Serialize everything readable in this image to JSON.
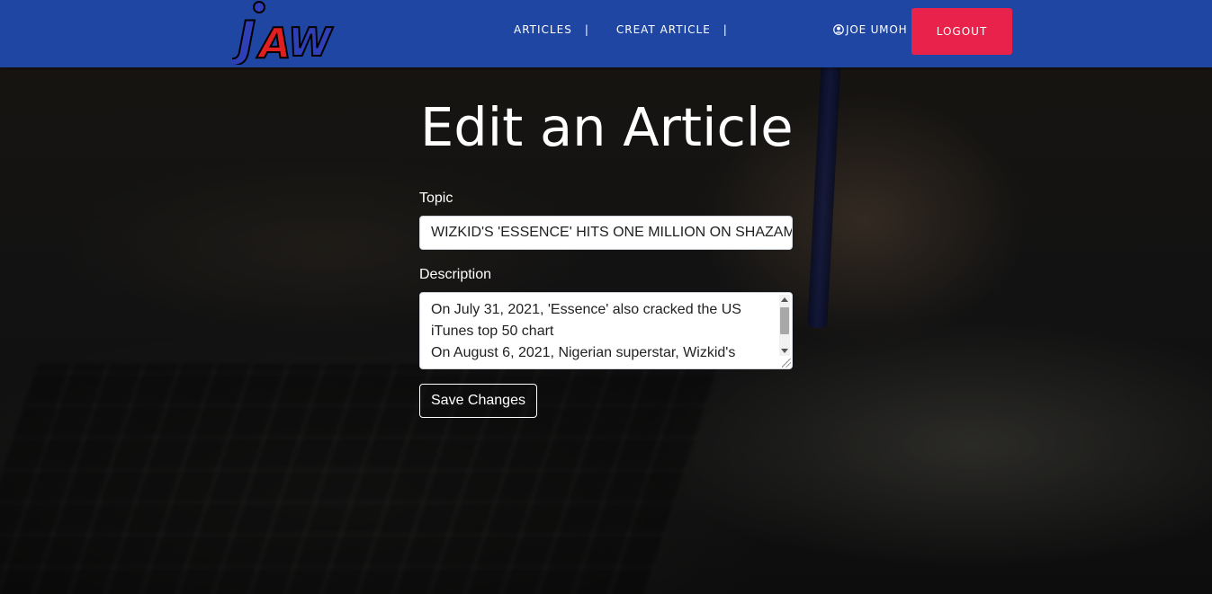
{
  "nav": {
    "logo_text": "JAW",
    "links": [
      {
        "label": "ARTICLES",
        "separator": "|"
      },
      {
        "label": "CREAT ARTICLE",
        "separator": "|"
      }
    ],
    "user_name": "JOE UMOH",
    "logout_label": "LOGOUT",
    "colors": {
      "bar": "#1e46a2",
      "logout": "#e8224a"
    }
  },
  "form": {
    "title": "Edit an Article",
    "topic_label": "Topic",
    "topic_value": "WIZKID'S 'ESSENCE' HITS ONE MILLION ON SHAZAM,",
    "description_label": "Description",
    "description_value": "On July 31, 2021, 'Essence' also cracked the US iTunes top 50 chart\nOn August 6, 2021, Nigerian superstar, Wizkid's",
    "save_label": "Save Changes"
  }
}
